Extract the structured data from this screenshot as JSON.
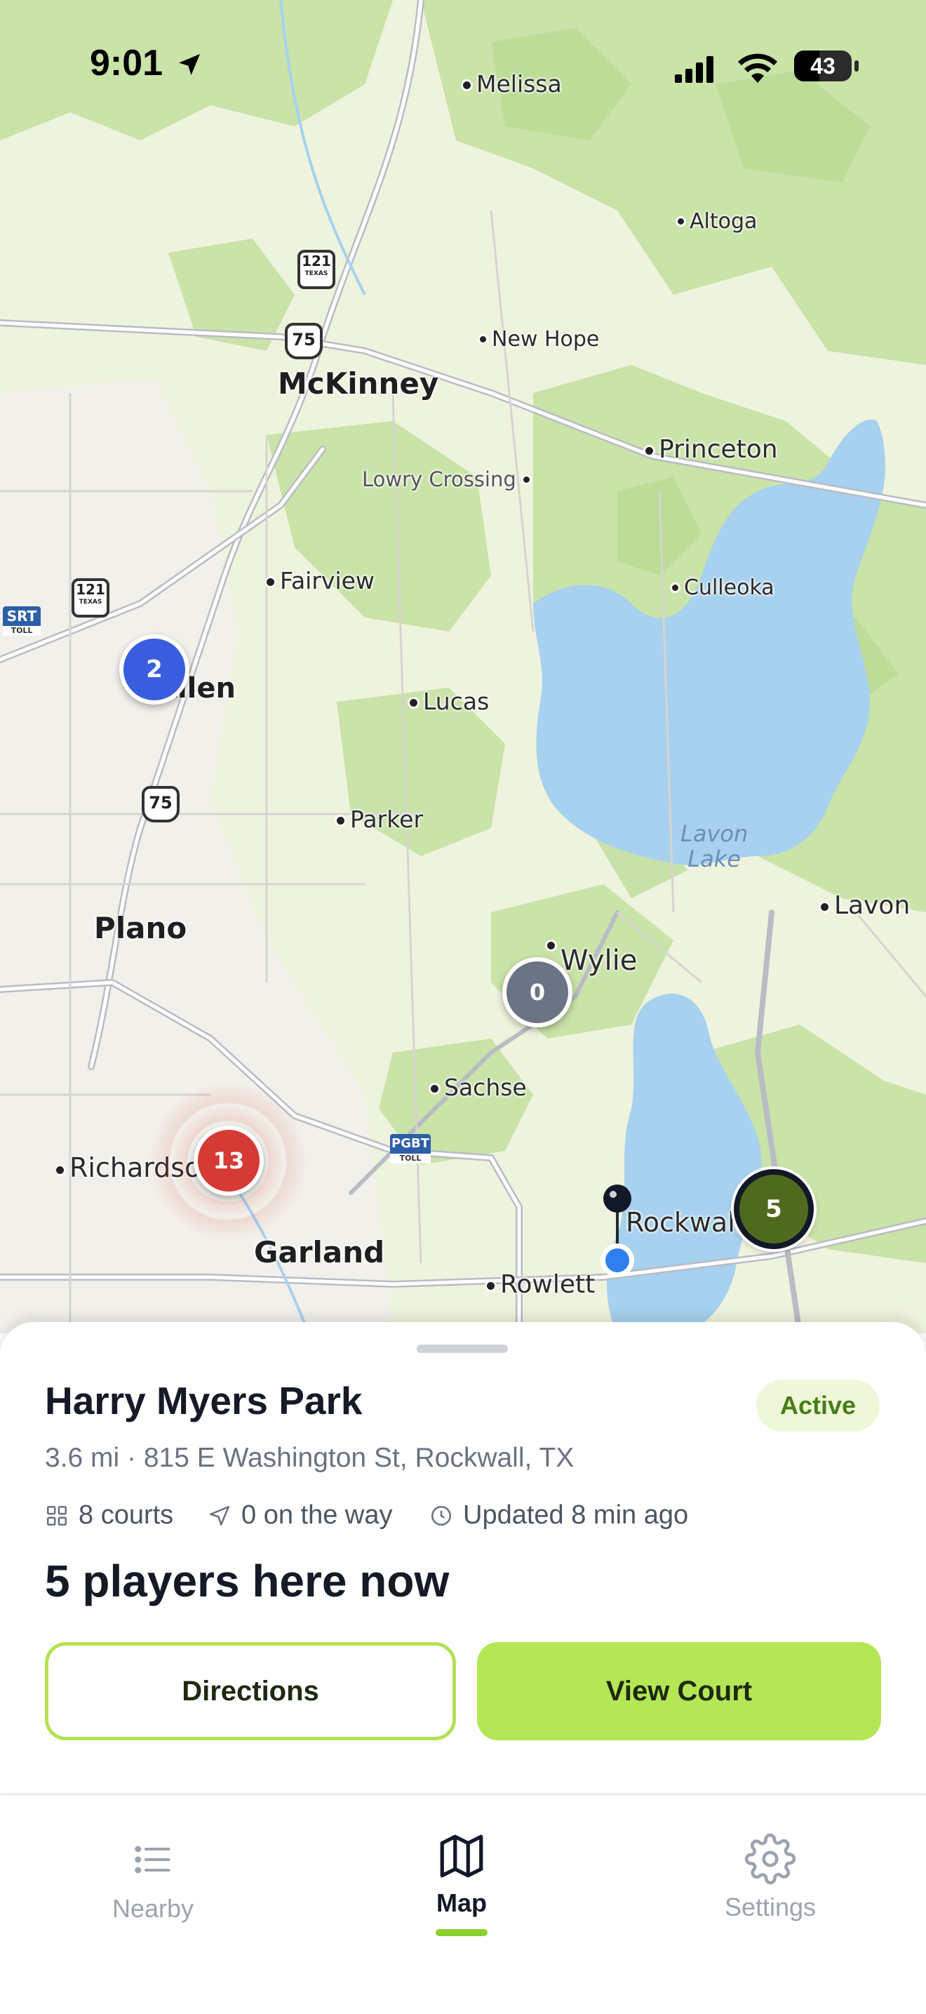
{
  "status_bar": {
    "time": "9:01",
    "battery": "43"
  },
  "map": {
    "towns": [
      {
        "name": "Melissa"
      },
      {
        "name": "Altoga"
      },
      {
        "name": "New Hope"
      },
      {
        "name": "Princeton"
      },
      {
        "name": "Lowry Crossing"
      },
      {
        "name": "Fairview"
      },
      {
        "name": "Culleoka"
      },
      {
        "name": "Lucas"
      },
      {
        "name": "Parker"
      },
      {
        "name": "Lavon"
      },
      {
        "name": "Wylie"
      },
      {
        "name": "Sachse"
      },
      {
        "name": "Richardson"
      },
      {
        "name": "Rowlett"
      },
      {
        "name": "Rockwall"
      }
    ],
    "cities": {
      "mckinney": "McKinney",
      "allen": "Allen",
      "plano": "Plano",
      "garland": "Garland"
    },
    "lake": "Lavon\nLake",
    "shields": {
      "hwy121_top": "121",
      "hwy121_left": "121",
      "texas": "TEXAS",
      "us75_top": "75",
      "us75_left": "75"
    },
    "tolls": {
      "srt": "SRT",
      "pgbt": "PGBT",
      "toll": "TOLL"
    },
    "clusters": {
      "allen": "2",
      "wylie": "0",
      "richardson": "13",
      "rockwall": "5"
    },
    "colors": {
      "blue": "#3a5de0",
      "gray": "#6b7485",
      "red": "#d63a34",
      "green": "#4f6a1e"
    }
  },
  "sheet": {
    "park_name": "Harry Myers Park",
    "status_badge": "Active",
    "address": "3.6 mi · 815 E Washington St, Rockwall, TX",
    "courts": "8 courts",
    "on_the_way": "0 on the way",
    "updated": "Updated 8 min ago",
    "players": "5 players here now",
    "directions_label": "Directions",
    "view_court_label": "View Court",
    "accent": "#b5e655"
  },
  "tabbar": {
    "nearby": "Nearby",
    "map": "Map",
    "settings": "Settings"
  }
}
